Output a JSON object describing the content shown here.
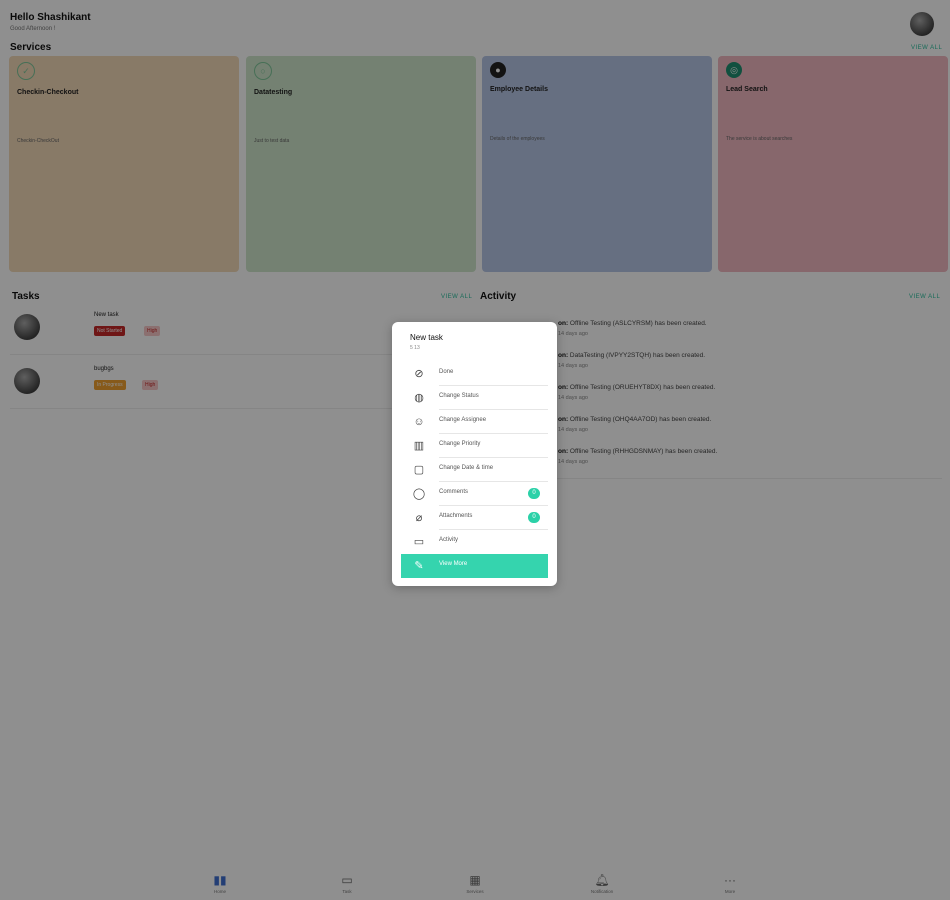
{
  "header": {
    "greeting": "Hello Shashikant",
    "subtitle": "Good Afternoon !"
  },
  "services": {
    "title": "Services",
    "view_all": "VIEW ALL",
    "cards": [
      {
        "title": "Checkin-Checkout",
        "description": "Checkin-CheckOut",
        "color": "#f3d9b8",
        "icon": "checkmark-icon"
      },
      {
        "title": "Datatesting",
        "description": "Just to test data",
        "color": "#cfe6cb",
        "icon": "data-icon"
      },
      {
        "title": "Employee Details",
        "description": "Details of the employees",
        "color": "#b6c6e6",
        "icon": "person-icon"
      },
      {
        "title": "Lead Search",
        "description": "The service is about searches",
        "color": "#f0b8c0",
        "icon": "search-icon"
      }
    ]
  },
  "tasks": {
    "title": "Tasks",
    "view_all": "VIEW ALL",
    "items": [
      {
        "name": "New task",
        "status": "Not Started",
        "priority": "High"
      },
      {
        "name": "bugbgs",
        "status": "In Progress",
        "priority": "High"
      }
    ]
  },
  "activity": {
    "title": "Activity",
    "view_all": "VIEW ALL",
    "items": [
      {
        "prefix": "on:",
        "text": "Offline Testing (ASLCYRSM) has been created.",
        "time": "14 days ago"
      },
      {
        "prefix": "on:",
        "text": "DataTesting (IVPYY2STQH) has been created.",
        "time": "14 days ago"
      },
      {
        "prefix": "on:",
        "text": "Offline Testing (ORUEHYT8DX) has been created.",
        "time": "14 days ago"
      },
      {
        "prefix": "on:",
        "text": "Offline Testing (OHQ4AA7OD) has been created.",
        "time": "14 days ago"
      },
      {
        "prefix": "on:",
        "text": "Offline Testing (RHHGDSNMAY) has been created.",
        "time": "14 days ago"
      }
    ]
  },
  "context_menu": {
    "title": "New task",
    "subtitle": "5 13",
    "items": [
      {
        "label": "Done",
        "icon": "check-circle-icon"
      },
      {
        "label": "Change Status",
        "icon": "status-icon"
      },
      {
        "label": "Change Assignee",
        "icon": "assignee-icon"
      },
      {
        "label": "Change Priority",
        "icon": "priority-bars-icon"
      },
      {
        "label": "Change Date & time",
        "icon": "calendar-icon"
      },
      {
        "label": "Comments",
        "icon": "comment-icon",
        "count": "0"
      },
      {
        "label": "Attachments",
        "icon": "paperclip-icon",
        "count": "0"
      },
      {
        "label": "Activity",
        "icon": "activity-icon"
      },
      {
        "label": "View More",
        "icon": "edit-icon"
      }
    ]
  },
  "tabbar": {
    "items": [
      {
        "label": "Home",
        "icon": "home-icon"
      },
      {
        "label": "Task",
        "icon": "task-icon"
      },
      {
        "label": "Services",
        "icon": "grid-icon"
      },
      {
        "label": "Notification",
        "icon": "bell-icon"
      },
      {
        "label": "More",
        "icon": "more-icon"
      }
    ]
  },
  "colors": {
    "accent": "#2bbf9d",
    "highlight": "#35d4ae",
    "status_red": "#c62828",
    "status_orange": "#f0a030"
  }
}
